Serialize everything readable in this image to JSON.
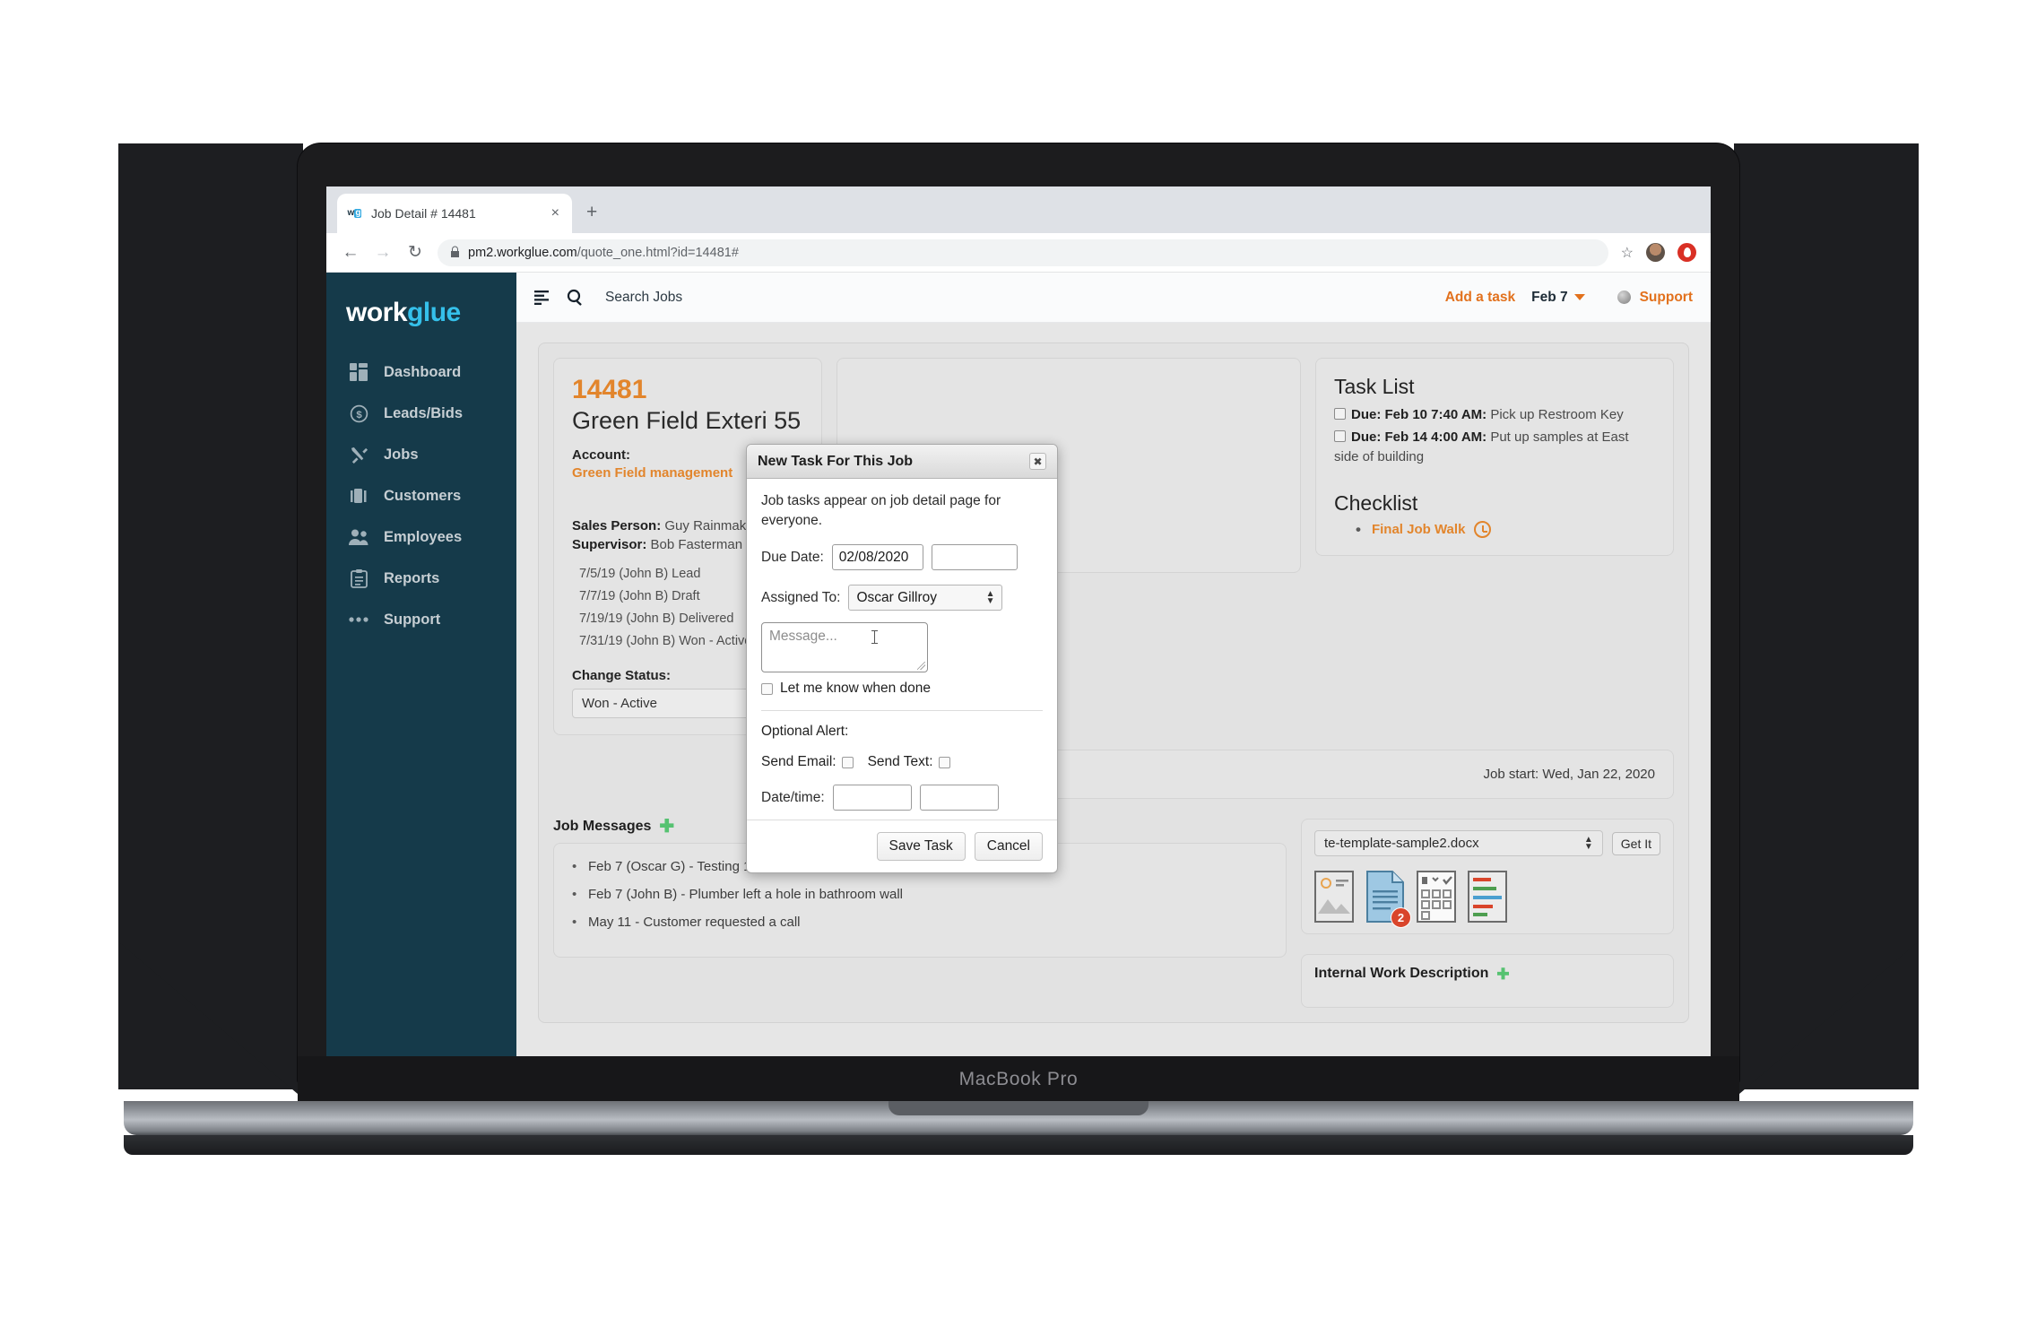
{
  "device": {
    "label": "MacBook Pro"
  },
  "browser": {
    "tab": {
      "favicon_w": "w",
      "favicon_g": "g",
      "title": "Job Detail # 14481",
      "close": "×"
    },
    "new_tab": "+",
    "nav": {
      "back": "←",
      "forward": "→",
      "reload": "↻"
    },
    "omnibox": {
      "lock": "🔒",
      "url_main": "pm2.workglue.com",
      "url_path": "/quote_one.html?id=14481#"
    },
    "star": "☆"
  },
  "sidebar": {
    "logo": {
      "work": "work",
      "glue": "glue"
    },
    "items": [
      {
        "label": "Dashboard",
        "icon": "grid-icon"
      },
      {
        "label": "Leads/Bids",
        "icon": "dollar-circle-icon"
      },
      {
        "label": "Jobs",
        "icon": "tools-icon"
      },
      {
        "label": "Customers",
        "icon": "briefcase-icon"
      },
      {
        "label": "Employees",
        "icon": "people-icon"
      },
      {
        "label": "Reports",
        "icon": "clipboard-icon"
      },
      {
        "label": "Support",
        "icon": "ellipsis-icon"
      }
    ]
  },
  "topbar": {
    "menu_icon": "filter-lines-icon",
    "search_icon": "search-icon",
    "search_label": "Search Jobs",
    "add_task": "Add a task",
    "date": "Feb 7",
    "support": "Support"
  },
  "job": {
    "number": "14481",
    "title": "Green Field Exteri 55",
    "account_label": "Account:",
    "account_name": "Green Field management",
    "sales_person_label": "Sales Person:",
    "sales_person": "Guy Rainmaker",
    "supervisor_label": "Supervisor:",
    "supervisor": "Bob Fasterman",
    "history": [
      "7/5/19 (John B)  Lead",
      "7/7/19 (John B)  Draft",
      "7/19/19 (John B)  Delivered",
      "7/31/19 (John B)  Won - Active"
    ],
    "change_status_label": "Change Status:",
    "status_value": "Won - Active"
  },
  "task_list": {
    "heading": "Task List",
    "items": [
      {
        "due": "Due: Feb 10 7:40 AM:",
        "text": " Pick up Restroom Key"
      },
      {
        "due": "Due: Feb 14 4:00 AM:",
        "text": " Put up samples at East side of building"
      }
    ]
  },
  "checklist": {
    "heading": "Checklist",
    "items": [
      {
        "label": "Final Job Walk",
        "icon": "clock-icon"
      }
    ]
  },
  "job_start": {
    "text": "Job start: Wed, Jan 22, 2020"
  },
  "messages": {
    "heading": "Job Messages",
    "add_icon": "plus-icon",
    "items": [
      "Feb 7 (Oscar G) - Testing 123",
      "Feb 7 (John B) - Plumber left a hole in bathroom wall",
      "May 11 - Customer requested a call"
    ]
  },
  "template": {
    "selected": "te-template-sample2.docx",
    "get_it": "Get It",
    "doc_icons": [
      {
        "name": "image-file-icon"
      },
      {
        "name": "document-file-icon",
        "badge": "2"
      },
      {
        "name": "form-file-icon"
      },
      {
        "name": "gantt-file-icon"
      }
    ]
  },
  "internal_work": {
    "heading": "Internal Work Description",
    "add_icon": "plus-icon"
  },
  "modal": {
    "title": "New Task For This Job",
    "close": "✖",
    "description": "Job tasks appear on job detail page for everyone.",
    "due_date_label": "Due Date:",
    "due_date_value": "02/08/2020",
    "due_time_value": "",
    "assigned_label": "Assigned To:",
    "assigned_value": "Oscar Gillroy",
    "message_placeholder": "Message...",
    "notify_label": "Let me know when done",
    "optional_alert_label": "Optional Alert:",
    "send_email_label": "Send Email:",
    "send_text_label": "Send Text:",
    "datetime_label": "Date/time:",
    "alert_date_value": "",
    "alert_time_value": "",
    "save_label": "Save Task",
    "cancel_label": "Cancel"
  },
  "colors": {
    "brand_orange": "#e2852c",
    "sidebar": "#153a4a",
    "logo_blue": "#35c0ea"
  }
}
